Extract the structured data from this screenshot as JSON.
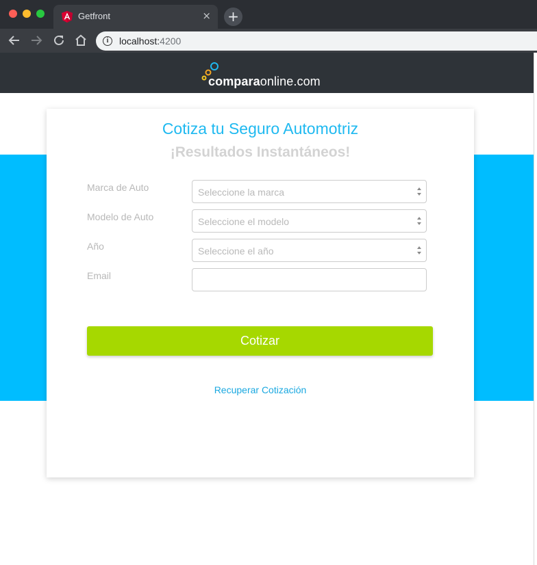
{
  "browser": {
    "tab_title": "Getfront",
    "tab_close": "×",
    "new_tab": "+",
    "url_host": "localhost:",
    "url_port": "4200"
  },
  "site": {
    "logo_bold": "compara",
    "logo_rest": "online.com"
  },
  "form": {
    "title": "Cotiza tu Seguro Automotriz",
    "subtitle": "¡Resultados Instantáneos!",
    "fields": [
      {
        "label": "Marca de Auto",
        "placeholder": "Seleccione la marca"
      },
      {
        "label": "Modelo de Auto",
        "placeholder": "Seleccione el modelo"
      },
      {
        "label": "Año",
        "placeholder": "Seleccione el año"
      },
      {
        "label": "Email",
        "value": ""
      }
    ],
    "submit_label": "Cotizar",
    "recover_link": "Recuperar Cotización"
  },
  "colors": {
    "accent_blue": "#00bdff",
    "title_blue": "#1fb9f0",
    "cta_green": "#a6d800",
    "header_dark": "#2e3338"
  }
}
